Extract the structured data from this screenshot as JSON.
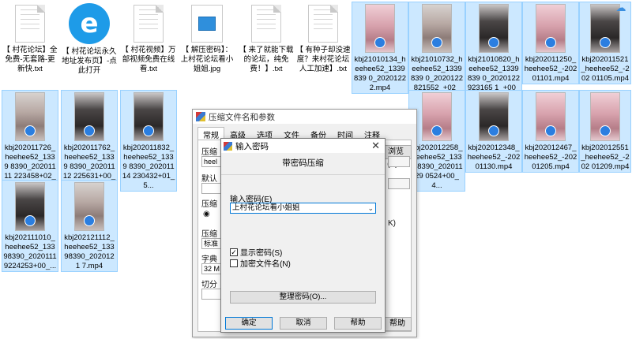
{
  "files": [
    {
      "type": "txt",
      "name": "【 村花论坛】全免费-无套路-更新快.txt"
    },
    {
      "type": "app",
      "name": "【 村花论坛永久地址发布页】-点此打开"
    },
    {
      "type": "txt",
      "name": "【 村花视频】万部视频免费在线看.txt"
    },
    {
      "type": "jpg",
      "name": "【 解压密码】：上村花论坛看小姐姐.jpg"
    },
    {
      "type": "txt",
      "name": "【 来了就能下载的论坛，纯免费！】.txt"
    },
    {
      "type": "txt",
      "name": "【 有种子却没速度？来村花论坛人工加速】.txt"
    },
    {
      "type": "vid",
      "name": "kbj21010134_heehee52_1339839 0_20201222.mp4"
    },
    {
      "type": "vid",
      "name": "kbj21010732_heehee52_1339839 0_2020122821552_+02_4..."
    },
    {
      "type": "vid",
      "name": "kbj21010820_heehee52_1339839 0_2020122923165 1_+00_2..."
    },
    {
      "type": "vid",
      "name": "kbj202011250_heehee52_-202 01101.mp4"
    },
    {
      "type": "vid",
      "name": "kbj202011521_heehee52_-202 01105.mp4"
    },
    {
      "type": "vid",
      "name": "kbj202011726_heehee52_1339 8390_20201111 223458+02_3..."
    },
    {
      "type": "vid",
      "name": "kbj202011762_heehee52_1339 8390_20201112 225631+00_3..."
    },
    {
      "type": "vid",
      "name": "kbj202011832_heehee52_1339 8390_20201114 230432+01_5..."
    },
    {
      "type": "vid",
      "name": "kbj202012258_heehee52_1339 8390_20201129 0524+00_4..."
    },
    {
      "type": "vid",
      "name": "kbj202012348_heehee52_-202 01130.mp4"
    },
    {
      "type": "vid",
      "name": "kbj202012467_heehee52_-202 01205.mp4"
    },
    {
      "type": "vid",
      "name": "kbj202012551_heehee52_-202 01209.mp4"
    },
    {
      "type": "vid",
      "name": "kbj202111010_heehee52_133 98390_2020111 9224253+00_..."
    },
    {
      "type": "vid",
      "name": "kbj202121112_heehee52_133 98390_2020121 7.mp4"
    }
  ],
  "back_dialog": {
    "title": "压缩文件名和参数",
    "tabs": [
      "常规",
      "高级",
      "选项",
      "文件",
      "备份",
      "时间",
      "注释"
    ],
    "label_name": "压缩",
    "name_value": "heel",
    "label_default": "默认",
    "label_format": "压缩",
    "label_method": "压缩",
    "method_value": "标准",
    "label_split": "字典",
    "split_value": "32 M",
    "label_volume": "切分",
    "browse_label": "浏览(B)...",
    "ok_k": "K)",
    "help_label": "帮助"
  },
  "dialog": {
    "title": "输入密码",
    "heading": "带密码压缩",
    "password_label": "输入密码(E)",
    "password_value": "上村花论坛看小姐姐",
    "show_password": "显示密码(S)",
    "show_password_checked": true,
    "encrypt_names": "加密文件名(N)",
    "encrypt_names_checked": false,
    "organize_button": "整理密码(O)...",
    "ok_button": "确定",
    "cancel_button": "取消",
    "help_button": "帮助"
  }
}
